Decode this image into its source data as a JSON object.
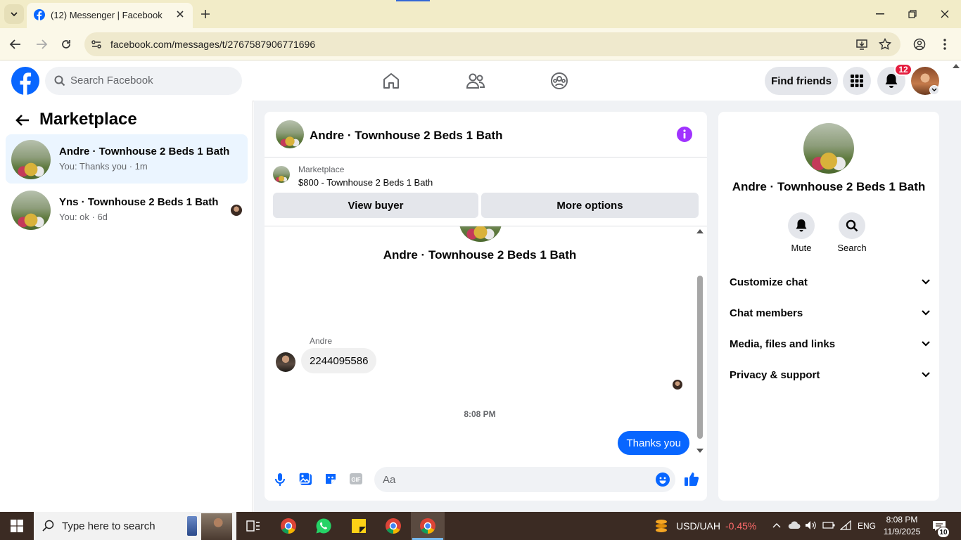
{
  "browser": {
    "tab_title": "(12) Messenger | Facebook",
    "url": "facebook.com/messages/t/2767587906771696"
  },
  "fb": {
    "search_placeholder": "Search Facebook",
    "find_friends": "Find friends",
    "notif_count": "12"
  },
  "sidebar": {
    "title": "Marketplace",
    "conversations": [
      {
        "name": "Andre · Townhouse 2 Beds 1 Bath",
        "preview": "You: Thanks you · 1m"
      },
      {
        "name": "Yns · Townhouse 2 Beds 1 Bath",
        "preview": "You: ok · 6d"
      }
    ]
  },
  "chat": {
    "title": "Andre · Townhouse 2 Beds 1 Bath",
    "listing_source": "Marketplace",
    "listing": "$800 - Townhouse 2 Beds 1 Bath",
    "view_buyer": "View buyer",
    "more_options": "More options",
    "intro_name": "Andre · Townhouse 2 Beds 1 Bath",
    "sender": "Andre",
    "msg_in": "2244095586",
    "time": "8:08 PM",
    "msg_out": "Thanks you",
    "composer_placeholder": "Aa"
  },
  "info": {
    "name": "Andre · Townhouse 2 Beds 1 Bath",
    "mute": "Mute",
    "search": "Search",
    "sections": [
      "Customize chat",
      "Chat members",
      "Media, files and links",
      "Privacy & support"
    ]
  },
  "taskbar": {
    "search_placeholder": "Type here to search",
    "ticker": "USD/UAH",
    "ticker_change": "-0.45%",
    "lang": "ENG",
    "time": "8:08 PM",
    "date": "11/9/2025",
    "notif": "10"
  },
  "colors": {
    "fb_blue": "#0866ff",
    "purple": "#a033ff",
    "ticker_red": "#ff6b6b"
  }
}
